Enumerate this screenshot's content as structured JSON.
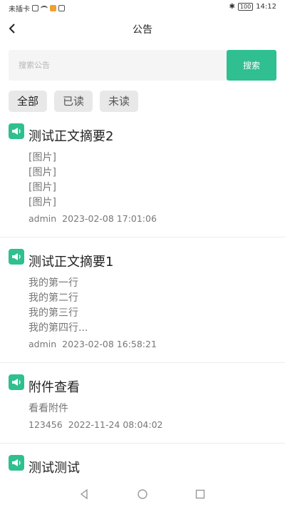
{
  "status_bar": {
    "carrier": "未插卡",
    "battery": "100",
    "time": "14:12"
  },
  "nav": {
    "title": "公告"
  },
  "search": {
    "placeholder": "搜索公告",
    "button_label": "搜索"
  },
  "filters": [
    {
      "label": "全部",
      "active": true
    },
    {
      "label": "已读"
    },
    {
      "label": "未读"
    }
  ],
  "notices": [
    {
      "title": "测试正文摘要2",
      "lines": [
        "[图片]",
        "[图片]",
        "[图片]",
        "[图片]"
      ],
      "author": "admin",
      "datetime": "2023-02-08 17:01:06"
    },
    {
      "title": "测试正文摘要1",
      "lines": [
        "我的第一行",
        "我的第二行",
        "我的第三行",
        "我的第四行..."
      ],
      "author": "admin",
      "datetime": "2023-02-08 16:58:21"
    },
    {
      "title": "附件查看",
      "lines": [
        "看看附件"
      ],
      "author": "123456",
      "datetime": "2022-11-24 08:04:02"
    },
    {
      "title": "测试测试",
      "lines": [],
      "author": "",
      "datetime": ""
    }
  ],
  "colors": {
    "accent": "#2fbf90",
    "background": "#ffffff",
    "input_bg": "#f5f5f5",
    "tab_bg": "#e8e8e8"
  }
}
